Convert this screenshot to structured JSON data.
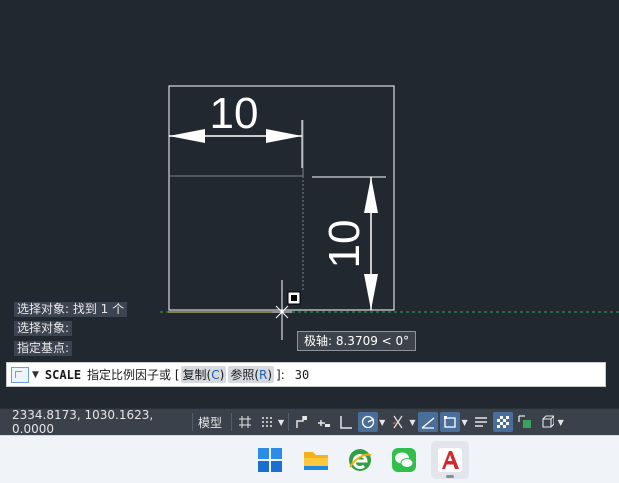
{
  "canvas": {
    "dimensions": [
      {
        "value": "10",
        "orientation": "horizontal"
      },
      {
        "value": "10",
        "orientation": "vertical"
      }
    ]
  },
  "history": {
    "lines": [
      "选择对象: 找到 1 个",
      "选择对象:",
      "指定基点:"
    ]
  },
  "tooltip": {
    "text": "极轴: 8.3709 < 0°"
  },
  "command": {
    "name": "SCALE",
    "prompt": "指定比例因子或 [",
    "option1_label": "复制(",
    "option1_key": "C",
    "option1_close": ")",
    "option2_label": "参照(",
    "option2_key": "R",
    "option2_close": ")",
    "suffix": "]:",
    "value": "30"
  },
  "status": {
    "coords": "2334.8173, 1030.1623, 0.0000",
    "model_label": "模型"
  },
  "colors": {
    "canvas_bg": "#212830",
    "geometry": "#ffffff",
    "ucs_line": "#2fa84f",
    "arrow": "#e03a2f",
    "statusbar": "#3a414a",
    "taskbar": "#f0f3f8"
  },
  "taskbar": {
    "apps": [
      "windows-start-icon",
      "file-explorer-icon",
      "browser-icon",
      "wechat-icon",
      "autocad-icon"
    ]
  }
}
